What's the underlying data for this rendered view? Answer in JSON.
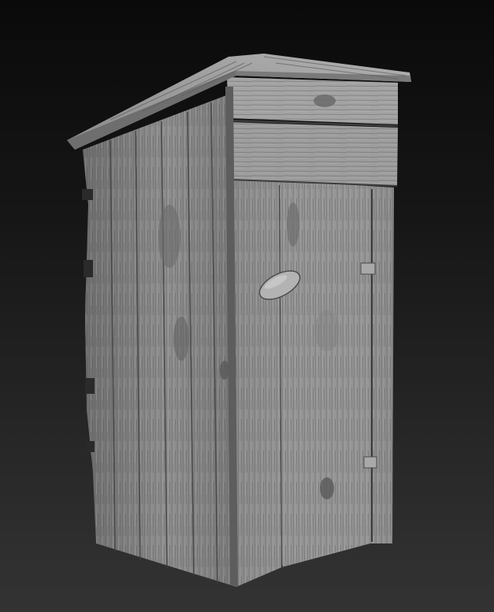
{
  "scene": {
    "subject": "outhouse-sculpt",
    "background_top": "#0a0a0a",
    "background_bottom": "#333333",
    "material_light": "#a6a6a6",
    "material_mid": "#7e7e7e",
    "material_dark": "#4a4a4a"
  }
}
